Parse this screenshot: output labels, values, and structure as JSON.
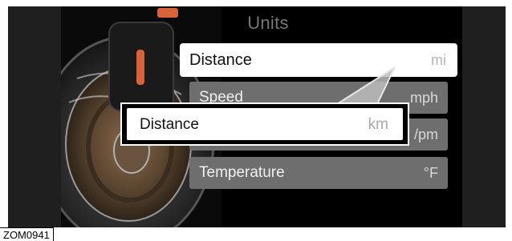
{
  "screen": {
    "title": "Units",
    "menu_items": [
      {
        "label": "Distance",
        "value": "mi"
      },
      {
        "label": "Speed",
        "value": "mph"
      },
      {
        "label": "",
        "value": "/pm"
      },
      {
        "label": "Temperature",
        "value": "°F"
      }
    ]
  },
  "callout": {
    "label": "Distance",
    "value": "km"
  },
  "figure_code": "ZOM0941",
  "colors": {
    "frame": "#000000",
    "side_panel": "#1f1f1f",
    "row_background": "#6e6e6e",
    "highlight_row": "#ffffff",
    "title_text": "#777777",
    "tire_accent": "#d8623a"
  }
}
